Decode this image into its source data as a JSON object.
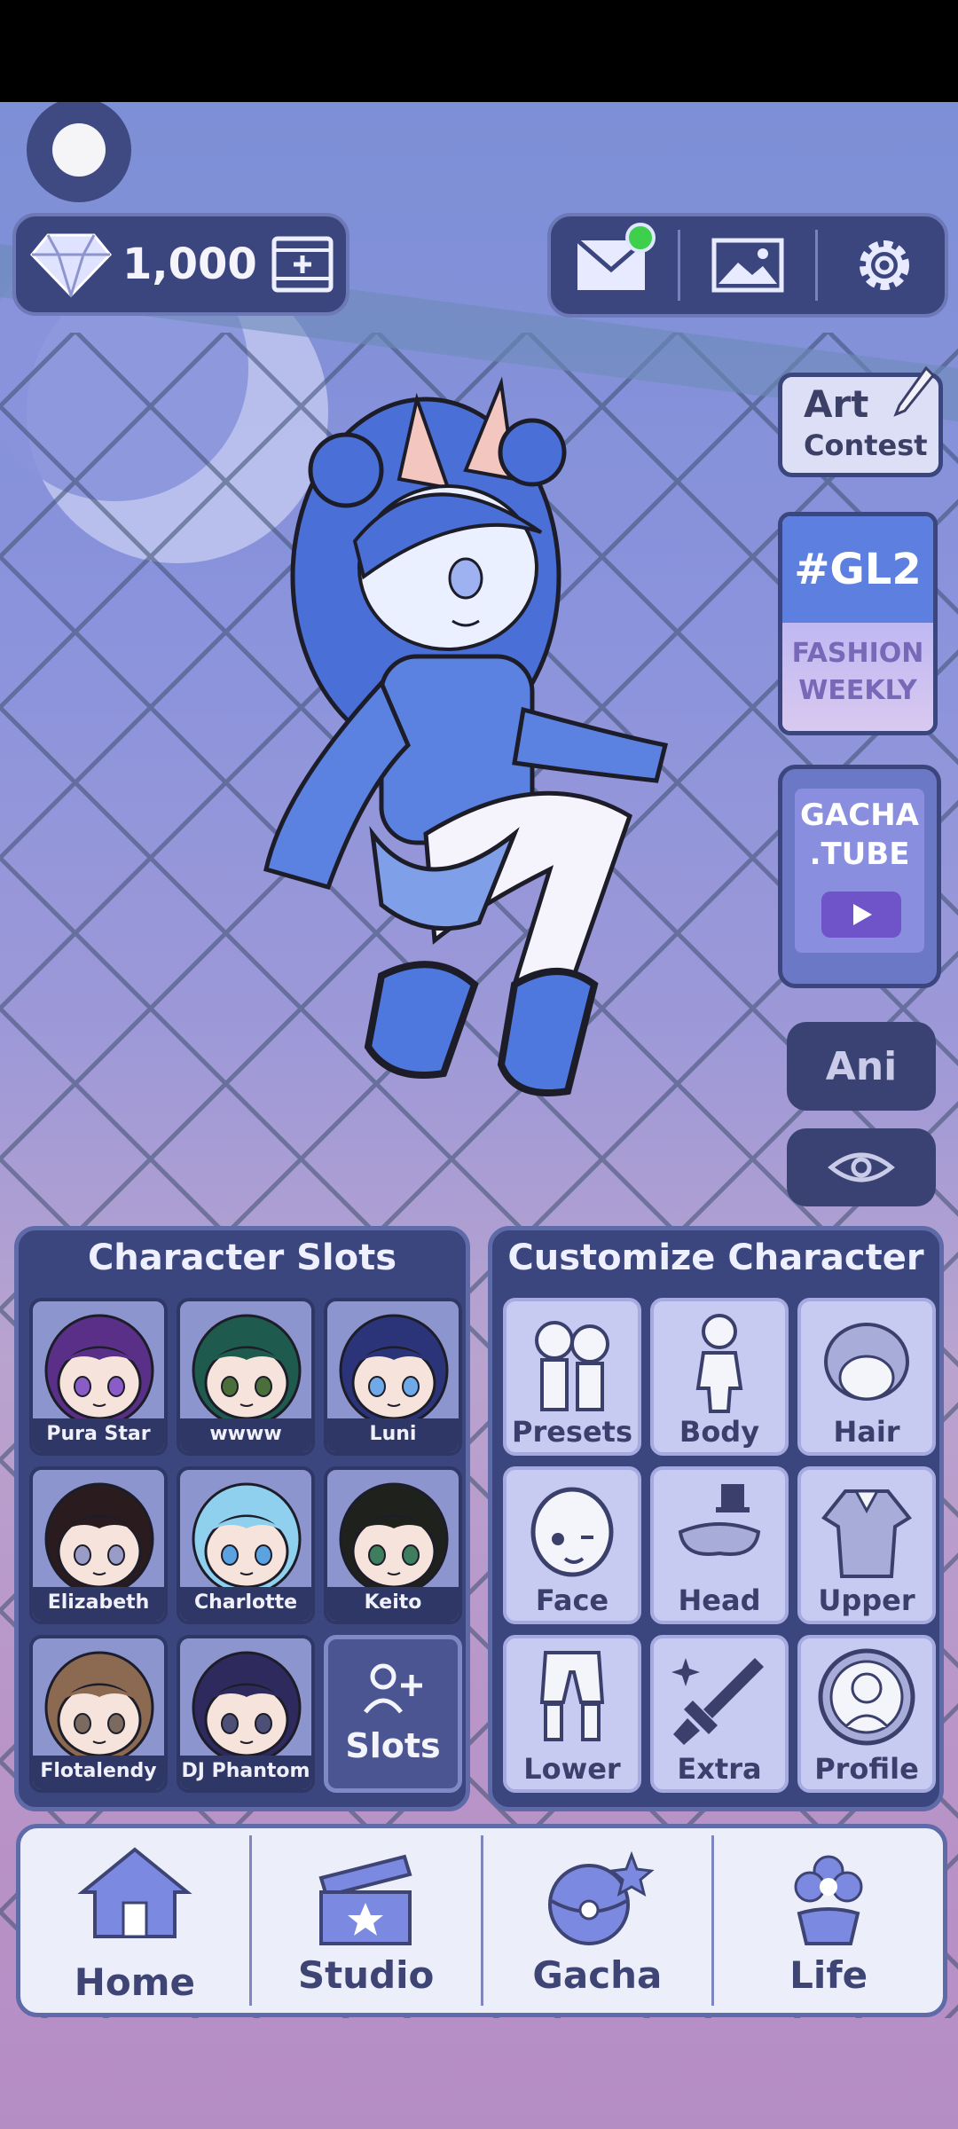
{
  "currency": {
    "icon": "diamond-icon",
    "amount": "1,000",
    "add_icon": "film-plus-icon"
  },
  "top_right": {
    "mail_icon": "mail-icon",
    "gallery_icon": "image-icon",
    "settings_icon": "gear-icon"
  },
  "side": {
    "art_line1": "Art",
    "art_line2": "Contest",
    "fashion_tag": "#GL2",
    "fashion_line1": "FASHION",
    "fashion_line2": "WEEKLY",
    "tube_line1": "GACHA",
    "tube_line2": ".TUBE",
    "ani": "Ani"
  },
  "slots_panel": {
    "title": "Character Slots",
    "slots": [
      {
        "name": "Pura Star",
        "hair": "#5a2f88",
        "eye": "#8a5cc8"
      },
      {
        "name": "wwww",
        "hair": "#1f5a4e",
        "eye": "#4a6f3a"
      },
      {
        "name": "Luni",
        "hair": "#2b3478",
        "eye": "#6fa9e8"
      },
      {
        "name": "Elizabeth",
        "hair": "#2a1b1e",
        "eye": "#9a9cc8"
      },
      {
        "name": "Charlotte",
        "hair": "#8fd0ef",
        "eye": "#5aa2e0"
      },
      {
        "name": "Keito",
        "hair": "#1f221c",
        "eye": "#3e7e5e"
      },
      {
        "name": "Flotalendy",
        "hair": "#8c6a52",
        "eye": "#7b6a60"
      },
      {
        "name": "DJ Phantom",
        "hair": "#2f2a5e",
        "eye": "#4e4f76"
      }
    ],
    "add_label": "Slots"
  },
  "customize_panel": {
    "title": "Customize Character",
    "items": [
      "Presets",
      "Body",
      "Hair",
      "Face",
      "Head",
      "Upper",
      "Lower",
      "Extra",
      "Profile"
    ]
  },
  "nav": {
    "items": [
      "Home",
      "Studio",
      "Gacha",
      "Life"
    ]
  }
}
